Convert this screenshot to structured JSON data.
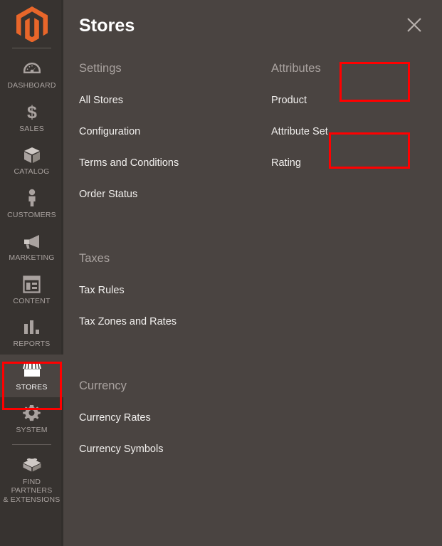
{
  "sidebar": {
    "logo": {
      "icon": "magento-logo-icon",
      "color": "#e8662a"
    },
    "items": [
      {
        "label": "DASHBOARD",
        "icon": "dashboard-gauge-icon",
        "active": false
      },
      {
        "label": "SALES",
        "icon": "dollar-sign-icon",
        "active": false
      },
      {
        "label": "CATALOG",
        "icon": "box-icon",
        "active": false
      },
      {
        "label": "CUSTOMERS",
        "icon": "person-icon",
        "active": false
      },
      {
        "label": "MARKETING",
        "icon": "megaphone-icon",
        "active": false
      },
      {
        "label": "CONTENT",
        "icon": "layout-page-icon",
        "active": false
      },
      {
        "label": "REPORTS",
        "icon": "bar-chart-icon",
        "active": false
      },
      {
        "label": "STORES",
        "icon": "storefront-icon",
        "active": true
      },
      {
        "label": "SYSTEM",
        "icon": "gear-icon",
        "active": false
      },
      {
        "label": "FIND PARTNERS\n& EXTENSIONS",
        "icon": "lego-brick-icon",
        "active": false
      }
    ]
  },
  "panel": {
    "title": "Stores",
    "close_icon": "close-icon",
    "left_column": [
      {
        "title": "Settings",
        "items": [
          {
            "label": "All Stores"
          },
          {
            "label": "Configuration"
          },
          {
            "label": "Terms and Conditions"
          },
          {
            "label": "Order Status"
          }
        ]
      },
      {
        "title": "Taxes",
        "items": [
          {
            "label": "Tax Rules"
          },
          {
            "label": "Tax Zones and Rates"
          }
        ]
      },
      {
        "title": "Currency",
        "items": [
          {
            "label": "Currency Rates"
          },
          {
            "label": "Currency Symbols"
          }
        ]
      }
    ],
    "right_column": [
      {
        "title": "Attributes",
        "items": [
          {
            "label": "Product"
          },
          {
            "label": "Attribute Set"
          },
          {
            "label": "Rating"
          }
        ]
      }
    ]
  },
  "annotations": {
    "color": "#ff0000",
    "boxes": [
      {
        "target": "STORES"
      },
      {
        "target": "Attributes"
      },
      {
        "target": "Attribute Set"
      }
    ]
  }
}
